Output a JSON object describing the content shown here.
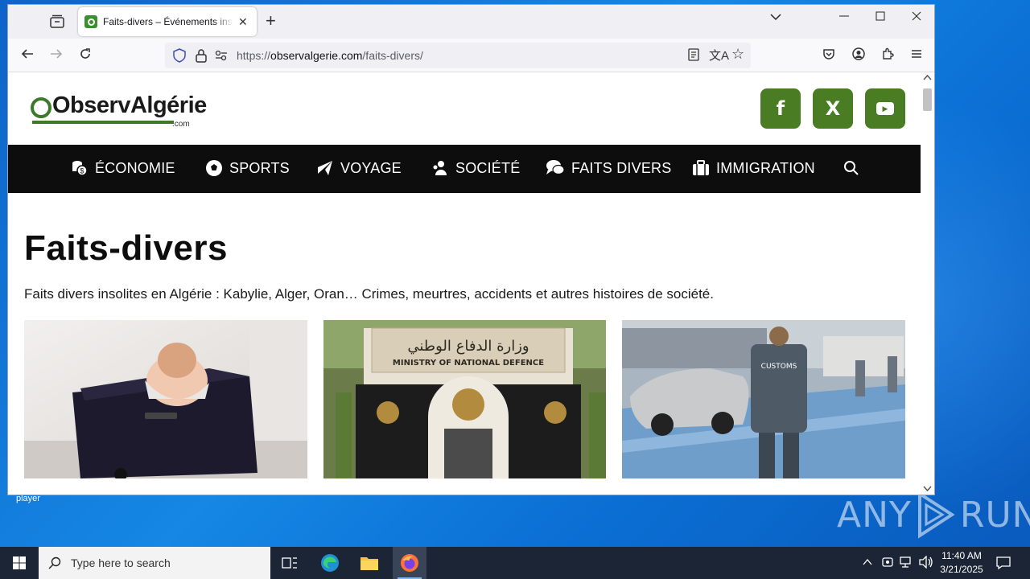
{
  "browser": {
    "tab_title": "Faits-divers – Événements insolites en Algérie",
    "url_prefix": "https://",
    "url_domain": "observalgerie.com",
    "url_path": "/faits-divers/"
  },
  "site": {
    "logo_part1": "Observ",
    "logo_part2": "Algérie",
    "logo_suffix": ".com",
    "social": [
      "f",
      "X",
      "▶"
    ],
    "menu": [
      {
        "label": "ÉCONOMIE",
        "icon": "coins-icon"
      },
      {
        "label": "SPORTS",
        "icon": "football-icon"
      },
      {
        "label": "VOYAGE",
        "icon": "plane-icon"
      },
      {
        "label": "SOCIÉTÉ",
        "icon": "users-icon"
      },
      {
        "label": "FAITS DIVERS",
        "icon": "comments-icon"
      },
      {
        "label": "IMMIGRATION",
        "icon": "suitcase-icon"
      }
    ]
  },
  "page": {
    "title": "Faits-divers",
    "intro": "Faits divers insolites en Algérie : Kabylie, Alger, Oran… Crimes, meurtres, accidents et autres histoires de société.",
    "cards": [
      {
        "image": "baby-in-suitcase-photo"
      },
      {
        "image": "ministry-of-national-defence-photo",
        "sign_ar": "وزارة الدفاع الوطني",
        "sign_en": "MINISTRY OF NATIONAL DEFENCE"
      },
      {
        "image": "customs-officers-photo",
        "badge": "CUSTOMS"
      }
    ]
  },
  "desktop": {
    "label": "player",
    "watermark_left": "ANY",
    "watermark_right": "RUN"
  },
  "taskbar": {
    "search_placeholder": "Type here to search",
    "time": "11:40 AM",
    "date": "3/21/2025"
  }
}
